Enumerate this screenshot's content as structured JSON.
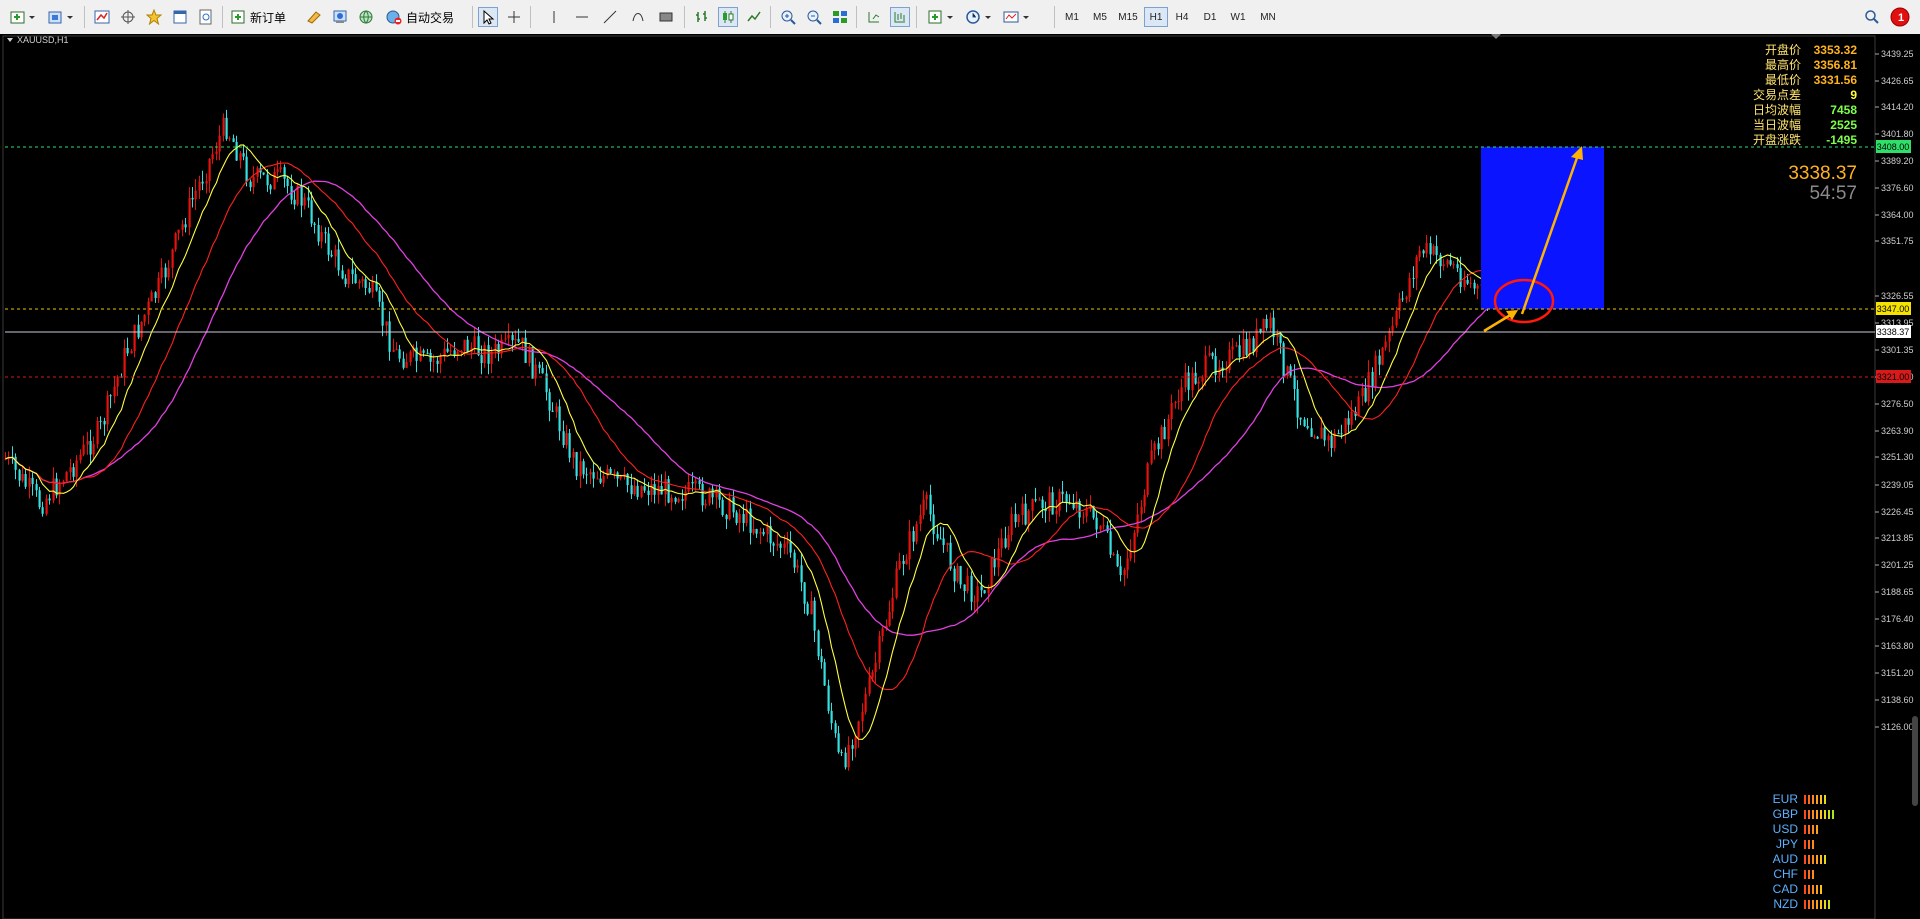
{
  "toolbar": {
    "new_order_label": "新订单",
    "auto_trade_label": "自动交易",
    "timeframes": [
      "M1",
      "M5",
      "M15",
      "H1",
      "H4",
      "D1",
      "W1",
      "MN"
    ],
    "active_timeframe": "H1",
    "notification_count": "1"
  },
  "chart": {
    "symbol_title": "XAUUSD,H1",
    "price_scale": [
      "3439.25",
      "3426.65",
      "3414.20",
      "3401.80",
      "3389.20",
      "3376.60",
      "3364.00",
      "3351.75",
      "3338.37",
      "3326.55",
      "3313.95",
      "3301.35",
      "3289.10",
      "3276.50",
      "3263.90",
      "3251.30",
      "3239.05",
      "3226.45",
      "3213.85",
      "3201.25",
      "3188.65",
      "3176.40",
      "3163.80",
      "3151.20",
      "3138.60",
      "3126.00"
    ],
    "level_tags": {
      "upper_target": "3408.00",
      "entry_level": "3347.00",
      "current_price": "3338.37",
      "stop_level": "3321.00"
    },
    "big_price": "3338.37",
    "countdown": "54:57",
    "colors": {
      "bull_candle": "#e8120c",
      "bear_candle": "#34e0e0",
      "ma_fast": "#ffff40",
      "ma_mid": "#ff2020",
      "ma_slow": "#e040e0",
      "target_box": "#0a14ff",
      "arrow": "#ffb300",
      "circle": "#ff1a0a"
    }
  },
  "info_panel": [
    {
      "label": "开盘价",
      "value": "3353.32",
      "color": "#ffb21f"
    },
    {
      "label": "最高价",
      "value": "3356.81",
      "color": "#ffb21f"
    },
    {
      "label": "最低价",
      "value": "3331.56",
      "color": "#ffb21f"
    },
    {
      "label": "交易点差",
      "value": "9",
      "color": "#ffff40"
    },
    {
      "label": "日均波幅",
      "value": "7458",
      "color": "#7dff4a"
    },
    {
      "label": "当日波幅",
      "value": "2525",
      "color": "#7dff4a"
    },
    {
      "label": "开盘涨跌",
      "value": "-1495",
      "color": "#7dff4a"
    }
  ],
  "currency_strength": [
    {
      "currency": "EUR",
      "level": 6
    },
    {
      "currency": "GBP",
      "level": 8
    },
    {
      "currency": "USD",
      "level": 4
    },
    {
      "currency": "JPY",
      "level": 3
    },
    {
      "currency": "AUD",
      "level": 6
    },
    {
      "currency": "CHF",
      "level": 3
    },
    {
      "currency": "CAD",
      "level": 5
    },
    {
      "currency": "NZD",
      "level": 7
    }
  ]
}
